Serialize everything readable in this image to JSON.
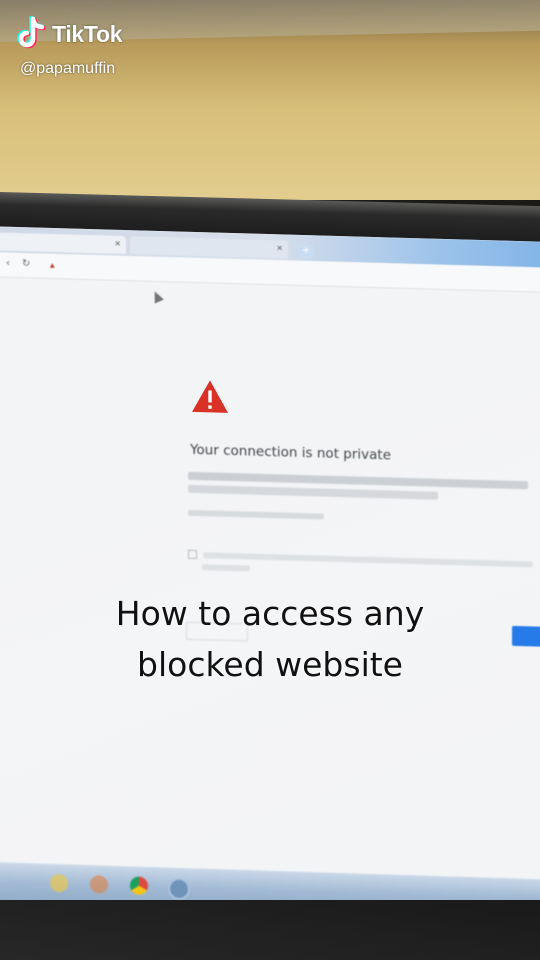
{
  "tiktok": {
    "brand": "TikTok",
    "handle": "@papamuffin"
  },
  "caption": {
    "line1": "How to access any",
    "line2": "blocked website"
  },
  "browser": {
    "error_title": "Your connection is not private"
  },
  "colors": {
    "warning_red": "#d93025",
    "chrome_blue": "#1a73e8",
    "caption_text": "#111111"
  },
  "icons": {
    "warning": "warning-triangle-icon",
    "tiktok": "tiktok-note-icon",
    "chrome": "chrome-icon"
  }
}
